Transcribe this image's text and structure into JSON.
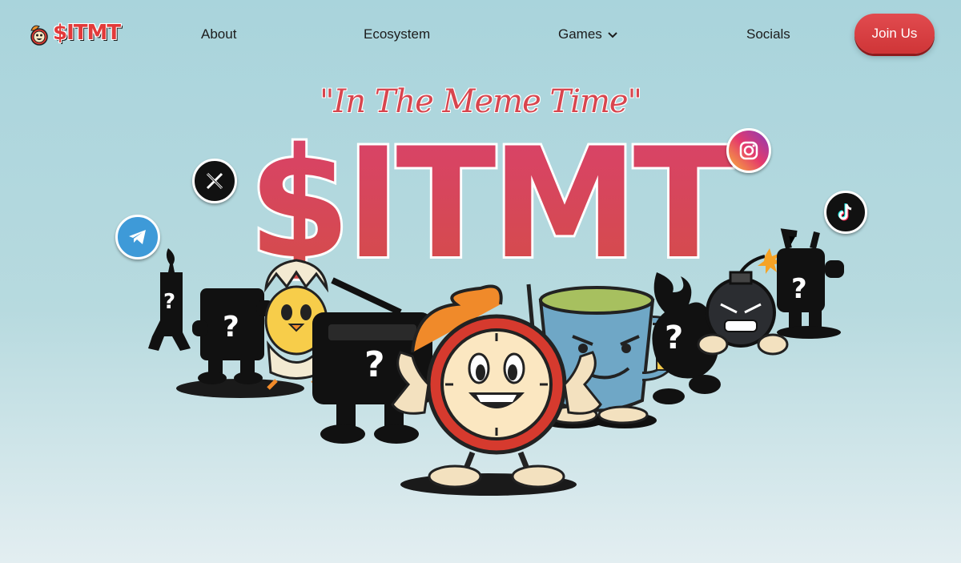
{
  "brand": {
    "logo_text": "$ITMT"
  },
  "nav": {
    "links": [
      {
        "label": "About"
      },
      {
        "label": "Ecosystem"
      },
      {
        "label": "Games"
      },
      {
        "label": "Socials"
      }
    ],
    "cta_label": "Join Us"
  },
  "hero": {
    "tagline": "\"In The Meme Time\"",
    "title": "$ITMT"
  },
  "socials": [
    {
      "name": "x-icon"
    },
    {
      "name": "telegram-icon"
    },
    {
      "name": "instagram-icon"
    },
    {
      "name": "tiktok-icon"
    }
  ],
  "colors": {
    "accent": "#d8454e",
    "button": "#d9403f",
    "background_top": "#a9d4dc",
    "background_bottom": "#e3eef1"
  }
}
